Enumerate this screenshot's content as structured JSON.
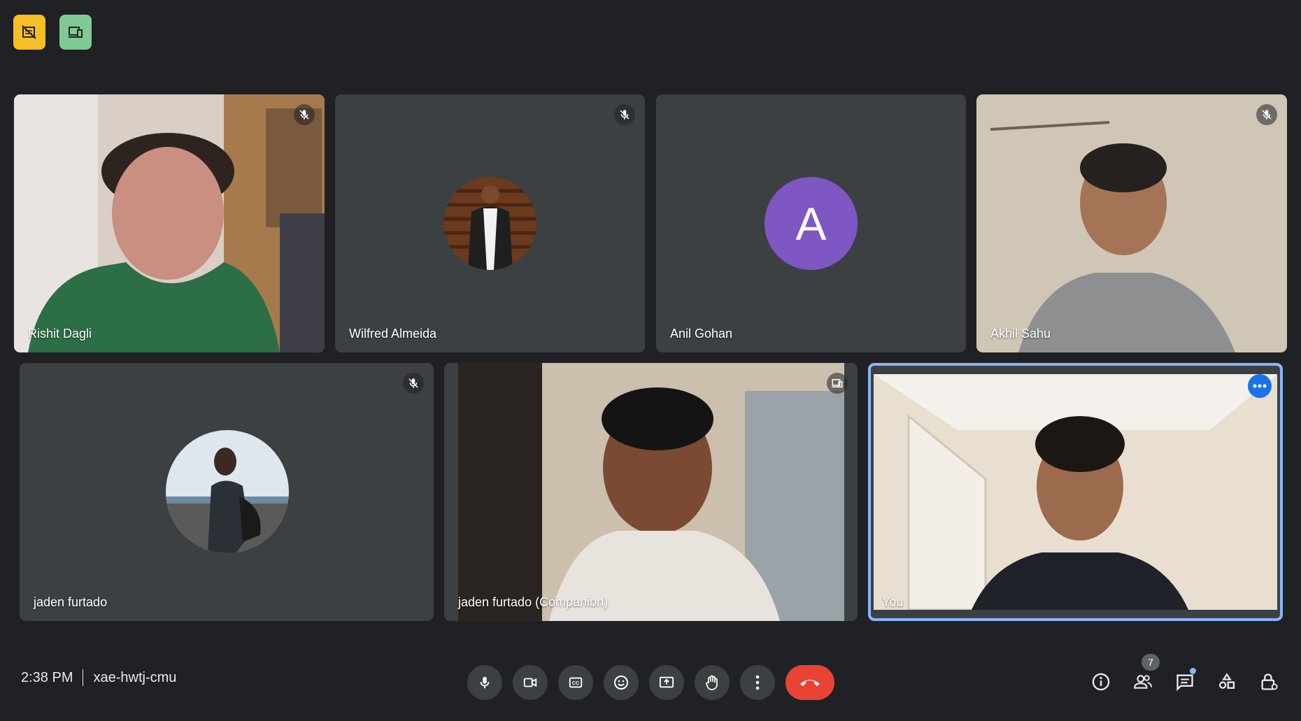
{
  "participants": [
    {
      "name": "Rishit Dagli",
      "muted": true
    },
    {
      "name": "Wilfred Almeida",
      "muted": true
    },
    {
      "name": "Anil Gohan",
      "initial": "A"
    },
    {
      "name": "Akhil Sahu",
      "muted": true
    },
    {
      "name": "jaden furtado",
      "muted": true
    },
    {
      "name": "jaden furtado (Companion)"
    },
    {
      "name": "You"
    }
  ],
  "meeting": {
    "time": "2:38 PM",
    "code": "xae-hwtj-cmu"
  },
  "people_count": "7",
  "colors": {
    "background": "#202124",
    "tile": "#3c4043",
    "end_call": "#ea4335",
    "selected_outline": "#8ab4f8",
    "avatar_purple": "#7e57c2"
  },
  "icons": [
    "no-video-badge-icon",
    "companion-mode-icon",
    "mic-off-icon",
    "mic-icon",
    "camera-icon",
    "captions-icon",
    "emoji-icon",
    "present-icon",
    "raise-hand-icon",
    "more-options-icon",
    "end-call-icon",
    "info-icon",
    "people-icon",
    "chat-icon",
    "activities-icon",
    "host-controls-icon"
  ]
}
